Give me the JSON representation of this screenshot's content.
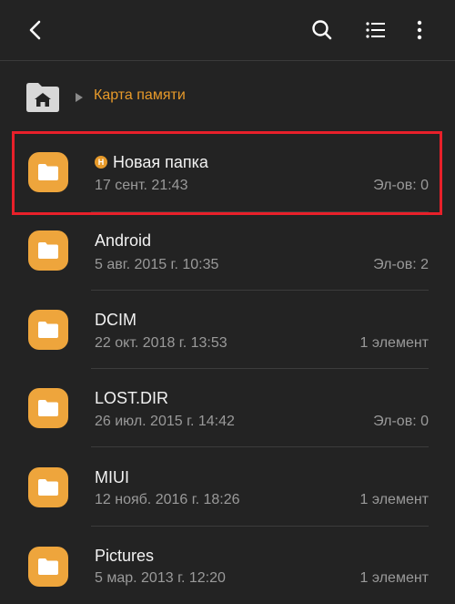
{
  "toolbar": {
    "back_icon": "back-arrow-icon",
    "search_icon": "search-icon",
    "list_view_icon": "list-view-icon",
    "more_icon": "more-vert-icon"
  },
  "breadcrumb": {
    "home_icon": "home-folder-icon",
    "current": "Карта памяти"
  },
  "items": [
    {
      "name": "Новая папка",
      "badge": "Н",
      "date": "17 сент. 21:43",
      "count": "Эл-ов: 0",
      "highlighted": true
    },
    {
      "name": "Android",
      "date": "5 авг. 2015 г. 10:35",
      "count": "Эл-ов: 2"
    },
    {
      "name": "DCIM",
      "date": "22 окт. 2018 г. 13:53",
      "count": "1 элемент"
    },
    {
      "name": "LOST.DIR",
      "date": "26 июл. 2015 г. 14:42",
      "count": "Эл-ов: 0"
    },
    {
      "name": "MIUI",
      "date": "12 нояб. 2016 г. 18:26",
      "count": "1 элемент"
    },
    {
      "name": "Pictures",
      "date": "5 мар. 2013 г. 12:20",
      "count": "1 элемент"
    }
  ],
  "colors": {
    "background": "#232323",
    "accent": "#e79a2a",
    "folder": "#eea53c",
    "highlight_border": "#e8202a"
  }
}
